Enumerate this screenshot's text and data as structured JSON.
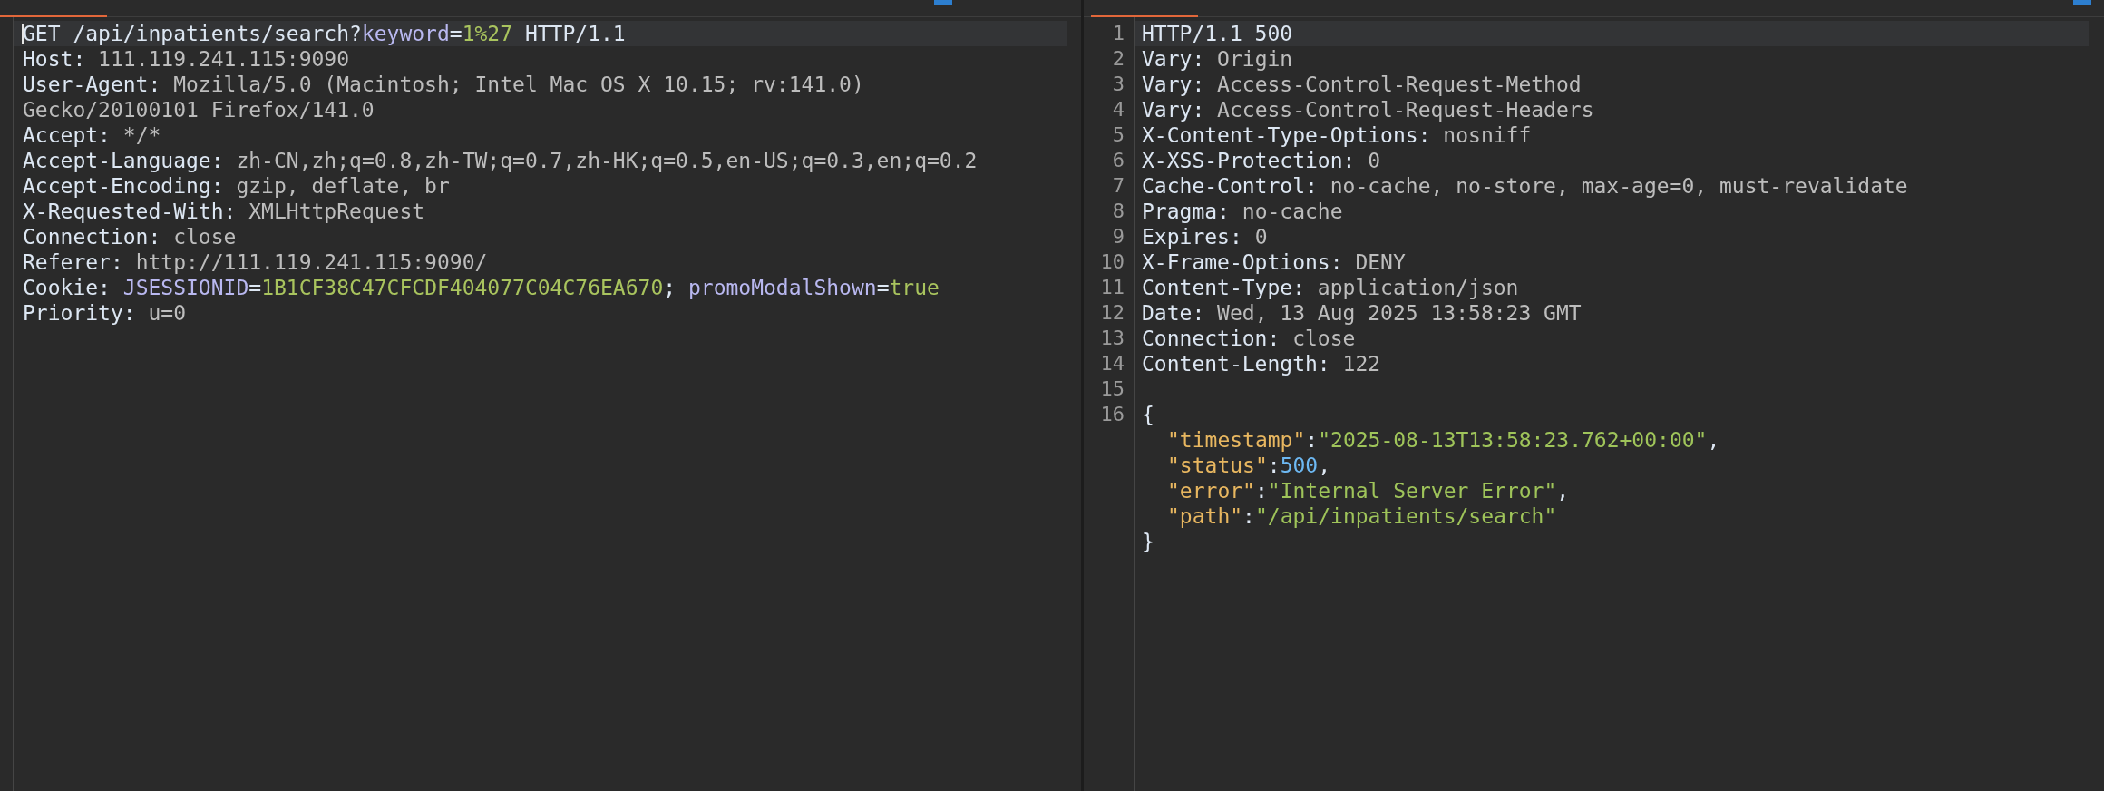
{
  "request": {
    "lines": [
      {
        "current": true,
        "segments": [
          {
            "kind": "key",
            "text": "GET /api/inpatients/search?"
          },
          {
            "kind": "param",
            "text": "keyword"
          },
          {
            "kind": "key",
            "text": "="
          },
          {
            "kind": "pval",
            "text": "1%27"
          },
          {
            "kind": "key",
            "text": " HTTP/1.1"
          }
        ]
      },
      {
        "current": false,
        "segments": [
          {
            "kind": "key",
            "text": "Host:"
          },
          {
            "kind": "val",
            "text": " 111.119.241.115:9090"
          }
        ]
      },
      {
        "current": false,
        "segments": [
          {
            "kind": "key",
            "text": "User-Agent:"
          },
          {
            "kind": "val",
            "text": " Mozilla/5.0 (Macintosh; Intel Mac OS X 10.15; rv:141.0)"
          }
        ]
      },
      {
        "current": false,
        "segments": [
          {
            "kind": "val",
            "text": "Gecko/20100101 Firefox/141.0"
          }
        ]
      },
      {
        "current": false,
        "segments": [
          {
            "kind": "key",
            "text": "Accept:"
          },
          {
            "kind": "val",
            "text": " */*"
          }
        ]
      },
      {
        "current": false,
        "segments": [
          {
            "kind": "key",
            "text": "Accept-Language:"
          },
          {
            "kind": "val",
            "text": " zh-CN,zh;q=0.8,zh-TW;q=0.7,zh-HK;q=0.5,en-US;q=0.3,en;q=0.2"
          }
        ]
      },
      {
        "current": false,
        "segments": [
          {
            "kind": "key",
            "text": "Accept-Encoding:"
          },
          {
            "kind": "val",
            "text": " gzip, deflate, br"
          }
        ]
      },
      {
        "current": false,
        "segments": [
          {
            "kind": "key",
            "text": "X-Requested-With:"
          },
          {
            "kind": "val",
            "text": " XMLHttpRequest"
          }
        ]
      },
      {
        "current": false,
        "segments": [
          {
            "kind": "key",
            "text": "Connection:"
          },
          {
            "kind": "val",
            "text": " close"
          }
        ]
      },
      {
        "current": false,
        "segments": [
          {
            "kind": "key",
            "text": "Referer:"
          },
          {
            "kind": "val",
            "text": " http://111.119.241.115:9090/"
          }
        ]
      },
      {
        "current": false,
        "segments": [
          {
            "kind": "key",
            "text": "Cookie: "
          },
          {
            "kind": "param",
            "text": "JSESSIONID"
          },
          {
            "kind": "key",
            "text": "="
          },
          {
            "kind": "pval",
            "text": "1B1CF38C47CFCDF404077C04C76EA670"
          },
          {
            "kind": "key",
            "text": "; "
          },
          {
            "kind": "param",
            "text": "promoModalShown"
          },
          {
            "kind": "key",
            "text": "="
          },
          {
            "kind": "pval",
            "text": "true"
          }
        ]
      },
      {
        "current": false,
        "segments": [
          {
            "kind": "key",
            "text": "Priority:"
          },
          {
            "kind": "val",
            "text": " u=0"
          }
        ]
      }
    ]
  },
  "response": {
    "lines": [
      {
        "number": "1",
        "current": true,
        "segments": [
          {
            "kind": "key",
            "text": "HTTP/1.1 500"
          }
        ]
      },
      {
        "number": "2",
        "current": false,
        "segments": [
          {
            "kind": "key",
            "text": "Vary:"
          },
          {
            "kind": "val",
            "text": " Origin"
          }
        ]
      },
      {
        "number": "3",
        "current": false,
        "segments": [
          {
            "kind": "key",
            "text": "Vary:"
          },
          {
            "kind": "val",
            "text": " Access-Control-Request-Method"
          }
        ]
      },
      {
        "number": "4",
        "current": false,
        "segments": [
          {
            "kind": "key",
            "text": "Vary:"
          },
          {
            "kind": "val",
            "text": " Access-Control-Request-Headers"
          }
        ]
      },
      {
        "number": "5",
        "current": false,
        "segments": [
          {
            "kind": "key",
            "text": "X-Content-Type-Options:"
          },
          {
            "kind": "val",
            "text": " nosniff"
          }
        ]
      },
      {
        "number": "6",
        "current": false,
        "segments": [
          {
            "kind": "key",
            "text": "X-XSS-Protection:"
          },
          {
            "kind": "val",
            "text": " 0"
          }
        ]
      },
      {
        "number": "7",
        "current": false,
        "segments": [
          {
            "kind": "key",
            "text": "Cache-Control:"
          },
          {
            "kind": "val",
            "text": " no-cache, no-store, max-age=0, must-revalidate"
          }
        ]
      },
      {
        "number": "8",
        "current": false,
        "segments": [
          {
            "kind": "key",
            "text": "Pragma:"
          },
          {
            "kind": "val",
            "text": " no-cache"
          }
        ]
      },
      {
        "number": "9",
        "current": false,
        "segments": [
          {
            "kind": "key",
            "text": "Expires:"
          },
          {
            "kind": "val",
            "text": " 0"
          }
        ]
      },
      {
        "number": "10",
        "current": false,
        "segments": [
          {
            "kind": "key",
            "text": "X-Frame-Options:"
          },
          {
            "kind": "val",
            "text": " DENY"
          }
        ]
      },
      {
        "number": "11",
        "current": false,
        "segments": [
          {
            "kind": "key",
            "text": "Content-Type:"
          },
          {
            "kind": "val",
            "text": " application/json"
          }
        ]
      },
      {
        "number": "12",
        "current": false,
        "segments": [
          {
            "kind": "key",
            "text": "Date:"
          },
          {
            "kind": "val",
            "text": " Wed, 13 Aug 2025 13:58:23 GMT"
          }
        ]
      },
      {
        "number": "13",
        "current": false,
        "segments": [
          {
            "kind": "key",
            "text": "Connection:"
          },
          {
            "kind": "val",
            "text": " close"
          }
        ]
      },
      {
        "number": "14",
        "current": false,
        "segments": [
          {
            "kind": "key",
            "text": "Content-Length:"
          },
          {
            "kind": "val",
            "text": " 122"
          }
        ]
      },
      {
        "number": "15",
        "current": false
      },
      {
        "number": "16",
        "current": false,
        "segments": [
          {
            "kind": "key",
            "text": "{"
          }
        ]
      },
      {
        "current": false,
        "indent": true,
        "segments": [
          {
            "kind": "jkey",
            "text": "\"timestamp\""
          },
          {
            "kind": "key",
            "text": ":"
          },
          {
            "kind": "jstr",
            "text": "\"2025-08-13T13:58:23.762+00:00\""
          },
          {
            "kind": "key",
            "text": ","
          }
        ]
      },
      {
        "current": false,
        "indent": true,
        "segments": [
          {
            "kind": "jkey",
            "text": "\"status\""
          },
          {
            "kind": "key",
            "text": ":"
          },
          {
            "kind": "jnum",
            "text": "500"
          },
          {
            "kind": "key",
            "text": ","
          }
        ]
      },
      {
        "current": false,
        "indent": true,
        "segments": [
          {
            "kind": "jkey",
            "text": "\"error\""
          },
          {
            "kind": "key",
            "text": ":"
          },
          {
            "kind": "jstr",
            "text": "\"Internal Server Error\""
          },
          {
            "kind": "key",
            "text": ","
          }
        ]
      },
      {
        "current": false,
        "indent": true,
        "segments": [
          {
            "kind": "jkey",
            "text": "\"path\""
          },
          {
            "kind": "key",
            "text": ":"
          },
          {
            "kind": "jstr",
            "text": "\"/api/inpatients/search\""
          }
        ]
      },
      {
        "current": false,
        "segments": [
          {
            "kind": "key",
            "text": "}"
          }
        ]
      }
    ]
  }
}
